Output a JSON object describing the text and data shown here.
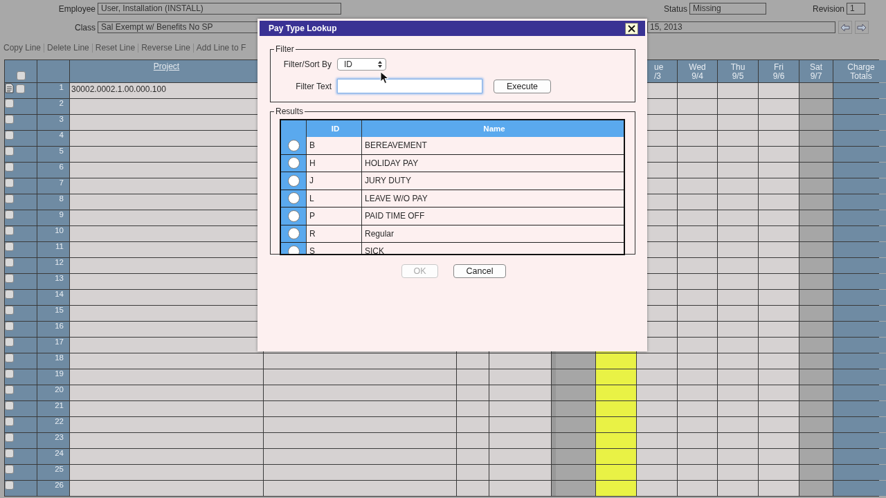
{
  "header": {
    "employee": {
      "label": "Employee",
      "value": "User, Installation (INSTALL)"
    },
    "status": {
      "label": "Status",
      "value": "Missing"
    },
    "revision": {
      "label": "Revision",
      "value": "1"
    },
    "class": {
      "label": "Class",
      "value": "Sal Exempt w/ Benefits No SP"
    },
    "period": {
      "value": "15, 2013"
    }
  },
  "toolbar": [
    "Copy Line",
    "Delete Line",
    "Reset Line",
    "Reverse Line",
    "Add Line to F"
  ],
  "grid": {
    "all_checked": false,
    "columns": [
      {
        "kind": "entry",
        "label": "Project"
      },
      {
        "kind": "entry"
      },
      {
        "kind": "entry"
      },
      {
        "kind": "entry"
      },
      {
        "kind": "weekend"
      },
      {
        "kind": "today"
      },
      {
        "kind": "entry",
        "day": "ue",
        "date": "/3"
      },
      {
        "kind": "entry",
        "day": "Wed",
        "date": "9/4"
      },
      {
        "kind": "entry",
        "day": "Thu",
        "date": "9/5"
      },
      {
        "kind": "entry",
        "day": "Fri",
        "date": "9/6"
      },
      {
        "kind": "weekend",
        "day": "Sat",
        "date": "9/7"
      },
      {
        "kind": "total",
        "day": "Charge",
        "date": "Totals"
      }
    ],
    "rows": [
      {
        "number": "1",
        "checked": false,
        "note": true,
        "project": "30002.0002.1.00.000.100"
      },
      {
        "number": "2",
        "checked": false,
        "note": false
      },
      {
        "number": "3",
        "checked": false,
        "note": false
      },
      {
        "number": "4",
        "checked": false,
        "note": false
      },
      {
        "number": "5",
        "checked": false,
        "note": false
      },
      {
        "number": "6",
        "checked": false,
        "note": false
      },
      {
        "number": "7",
        "checked": false,
        "note": false
      },
      {
        "number": "8",
        "checked": false,
        "note": false
      },
      {
        "number": "9",
        "checked": false,
        "note": false
      },
      {
        "number": "10",
        "checked": false,
        "note": false
      },
      {
        "number": "11",
        "checked": false,
        "note": false
      },
      {
        "number": "12",
        "checked": false,
        "note": false
      },
      {
        "number": "13",
        "checked": false,
        "note": false
      },
      {
        "number": "14",
        "checked": false,
        "note": false
      },
      {
        "number": "15",
        "checked": false,
        "note": false
      },
      {
        "number": "16",
        "checked": false,
        "note": false
      },
      {
        "number": "17",
        "checked": false,
        "note": false
      },
      {
        "number": "18",
        "checked": false,
        "note": false
      },
      {
        "number": "19",
        "checked": false,
        "note": false
      },
      {
        "number": "20",
        "checked": false,
        "note": false
      },
      {
        "number": "21",
        "checked": false,
        "note": false
      },
      {
        "number": "22",
        "checked": false,
        "note": false
      },
      {
        "number": "23",
        "checked": false,
        "note": false
      },
      {
        "number": "24",
        "checked": false,
        "note": false
      },
      {
        "number": "25",
        "checked": false,
        "note": false
      },
      {
        "number": "26",
        "checked": false,
        "note": false
      }
    ]
  },
  "dialog": {
    "title": "Pay Type Lookup",
    "filter": {
      "legend": "Filter",
      "sort_label": "Filter/Sort By",
      "sort_value": "ID",
      "text_label": "Filter Text",
      "execute": "Execute"
    },
    "results": {
      "legend": "Results",
      "columns": [
        "ID",
        "Name"
      ],
      "rows": [
        {
          "id": "B",
          "name": "BEREAVEMENT",
          "selected": false
        },
        {
          "id": "H",
          "name": "HOLIDAY PAY",
          "selected": false
        },
        {
          "id": "J",
          "name": "JURY DUTY",
          "selected": false
        },
        {
          "id": "L",
          "name": "LEAVE W/O PAY",
          "selected": false
        },
        {
          "id": "P",
          "name": "PAID TIME OFF",
          "selected": false
        },
        {
          "id": "R",
          "name": "Regular",
          "selected": false
        },
        {
          "id": "S",
          "name": "SICK",
          "selected": false
        }
      ]
    },
    "buttons": [
      {
        "label": "OK",
        "disabled": true
      },
      {
        "label": "Cancel",
        "disabled": false
      }
    ]
  }
}
